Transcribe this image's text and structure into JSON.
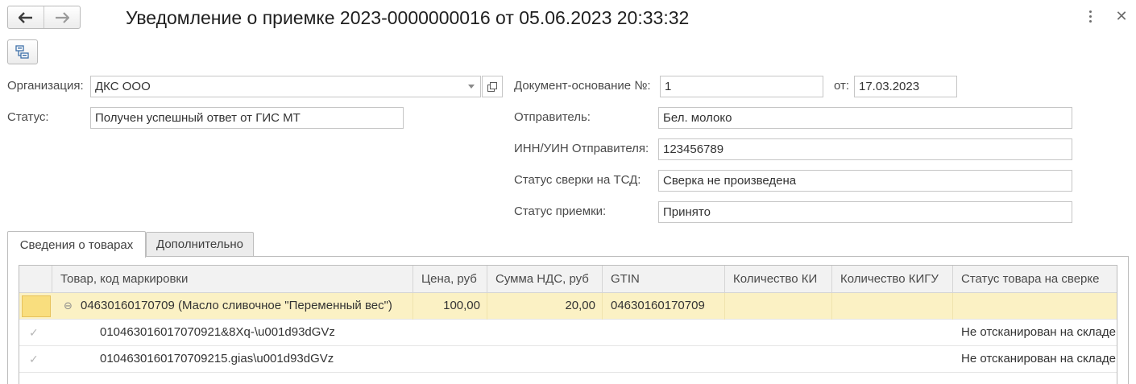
{
  "window": {
    "title": "Уведомление о приемке 2023-0000000016 от 05.06.2023 20:33:32",
    "back_icon": "arrow-left-icon",
    "forward_icon": "arrow-right-icon",
    "more_icon": "more-vertical-icon",
    "close_glyph": "✕"
  },
  "form": {
    "organization_label": "Организация:",
    "organization_value": "ДКС ООО",
    "status_label": "Статус:",
    "status_value": "Получен успешный ответ от ГИС МТ",
    "base_doc_label": "Документ-основание №:",
    "base_doc_value": "1",
    "base_doc_date_label": "от:",
    "base_doc_date_value": "17.03.2023",
    "sender_label": "Отправитель:",
    "sender_value": "Бел. молоко",
    "sender_inn_label": "ИНН/УИН Отправителя:",
    "sender_inn_value": "123456789",
    "tsd_status_label": "Статус сверки на ТСД:",
    "tsd_status_value": "Сверка не произведена",
    "acceptance_status_label": "Статус приемки:",
    "acceptance_status_value": "Принято"
  },
  "tabs": [
    {
      "label": "Сведения о товарах",
      "active": true
    },
    {
      "label": "Дополнительно",
      "active": false
    }
  ],
  "table": {
    "columns": [
      "Товар, код маркировки",
      "Цена, руб",
      "Сумма НДС, руб",
      "GTIN",
      "Количество КИ",
      "Количество КИГУ",
      "Статус товара на сверке"
    ],
    "rows": [
      {
        "product": "04630160170709 (Масло сливочное \"Переменный вес\")",
        "price": "100,00",
        "vat": "20,00",
        "gtin": "04630160170709",
        "qty_ki": "",
        "qty_kigu": "",
        "status": ""
      },
      {
        "product": "010463016017070921&8Xq-\\u001d93dGVz",
        "price": "",
        "vat": "",
        "gtin": "",
        "qty_ki": "",
        "qty_kigu": "",
        "status": "Не отсканирован на складе"
      },
      {
        "product": "0104630160170709215.gias\\u001d93dGVz",
        "price": "",
        "vat": "",
        "gtin": "",
        "qty_ki": "",
        "qty_kigu": "",
        "status": "Не отсканирован на складе"
      }
    ]
  },
  "colors": {
    "selected_row": "#fbf1c4",
    "selected_marker": "#f9de7e",
    "header_bg": "#f2f2f2",
    "border": "#bdbdbd"
  }
}
